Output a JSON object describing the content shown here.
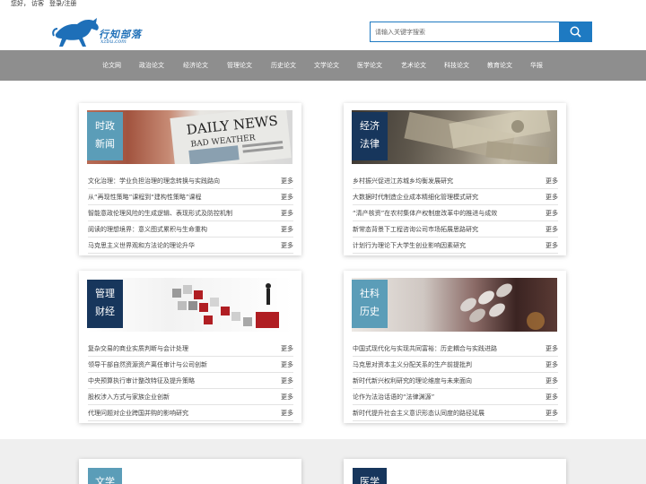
{
  "topbar": {
    "hello": "您好，",
    "guest": "访客",
    "login": "登录/注册"
  },
  "logo": {
    "text": "行知部落",
    "sub": "xzbu.com"
  },
  "search": {
    "placeholder": "请输入关键字搜索"
  },
  "nav": [
    "论文网",
    "政治论文",
    "经济论文",
    "管理论文",
    "历史论文",
    "文学论文",
    "医学论文",
    "艺术论文",
    "科技论文",
    "教育论文",
    "华报"
  ],
  "colors": {
    "accent": "#1e7ac2",
    "nav_bg": "#8e8e8e",
    "tag_teal": "#5b9db8",
    "tag_navy": "#17365c"
  },
  "cards": [
    {
      "tag_line1": "时政",
      "tag_line2": "新闻",
      "rows": [
        {
          "title": "文化治理：学业负担治理的理念转换与实践路向",
          "more": "更多"
        },
        {
          "title": "从“再现性策略”课程到“建构性策略”课程",
          "more": "更多"
        },
        {
          "title": "智能意政伦理风险的生成逻辑、表现形式及防控机制",
          "more": "更多"
        },
        {
          "title": "阅读的理想境界：意义图式累积与生命重构",
          "more": "更多"
        },
        {
          "title": "马克思主义世界观和方法论的理论升华",
          "more": "更多"
        }
      ]
    },
    {
      "tag_line1": "经济",
      "tag_line2": "法律",
      "rows": [
        {
          "title": "乡村振兴促进江苏城乡均衡发展研究",
          "more": "更多"
        },
        {
          "title": "大数据时代制造企业成本精细化管理模式研究",
          "more": "更多"
        },
        {
          "title": "“清产核资”在农村集体产权制度改革中的推进与成效",
          "more": "更多"
        },
        {
          "title": "新常态背景下工程咨询公司市场拓展思路研究",
          "more": "更多"
        },
        {
          "title": "计划行为理论下大学生创业影响因素研究",
          "more": "更多"
        }
      ]
    },
    {
      "tag_line1": "管理",
      "tag_line2": "财经",
      "rows": [
        {
          "title": "复杂交易的商业实质判断与会计处理",
          "more": "更多"
        },
        {
          "title": "领导干部自然资源资产离任审计与公司创新",
          "more": "更多"
        },
        {
          "title": "中央预算执行审计整改特征及提升策略",
          "more": "更多"
        },
        {
          "title": "股权涉入方式与家族企业创新",
          "more": "更多"
        },
        {
          "title": "代理问题对企业跨国并购的影响研究",
          "more": "更多"
        }
      ]
    },
    {
      "tag_line1": "社科",
      "tag_line2": "历史",
      "rows": [
        {
          "title": "中国式现代化与实现共同富裕：历史耦合与实践进路",
          "more": "更多"
        },
        {
          "title": "马克思对资本主义分配关系的生产前提批判",
          "more": "更多"
        },
        {
          "title": "新时代新兴权利研究的理论维度与未来面向",
          "more": "更多"
        },
        {
          "title": "论作为法治话语的“法律渊源”",
          "more": "更多"
        },
        {
          "title": "新时代提升社会主义意识形态认同度的路径延展",
          "more": "更多"
        }
      ]
    }
  ],
  "band_cards": [
    {
      "tag": "文学"
    },
    {
      "tag": "医学"
    }
  ]
}
